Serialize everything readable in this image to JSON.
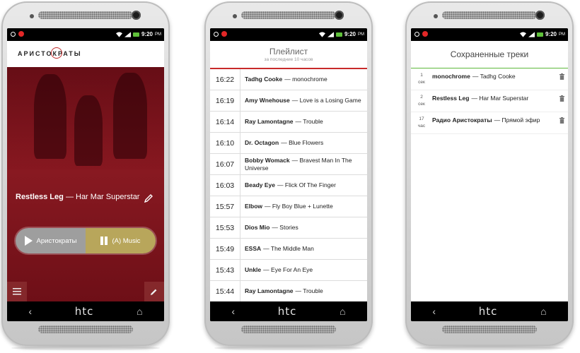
{
  "status_time": "9:20",
  "status_ampm": "PM",
  "nav_brand": "htc",
  "phone1": {
    "logo": "АРИСТОКРАТЫ",
    "artist": "Restless Leg",
    "title": "Har Mar Superstar",
    "btn_primary": "Аристократы",
    "btn_secondary": "(A) Music"
  },
  "playlist": {
    "title": "Плейлист",
    "subtitle": "за последние 10 часов",
    "items": [
      {
        "time": "16:22",
        "artist": "Tadhg Cooke",
        "title": "monochrome"
      },
      {
        "time": "16:19",
        "artist": "Amy Wnehouse",
        "title": "Love is a Losing Game"
      },
      {
        "time": "16:14",
        "artist": "Ray Lamontagne",
        "title": "Trouble"
      },
      {
        "time": "16:10",
        "artist": "Dr. Octagon",
        "title": "Blue Flowers"
      },
      {
        "time": "16:07",
        "artist": "Bobby Womack",
        "title": "Bravest Man In The Universe"
      },
      {
        "time": "16:03",
        "artist": "Beady Eye",
        "title": "Flick Of The Finger"
      },
      {
        "time": "15:57",
        "artist": "Elbow",
        "title": "Fly Boy Blue + Lunette"
      },
      {
        "time": "15:53",
        "artist": "Dios Mio",
        "title": "Stories"
      },
      {
        "time": "15:49",
        "artist": "ESSA",
        "title": "The Middle Man"
      },
      {
        "time": "15:43",
        "artist": "Unkle",
        "title": "Eye For An Eye"
      },
      {
        "time": "15:44",
        "artist": "Ray Lamontagne",
        "title": "Trouble"
      }
    ]
  },
  "saved": {
    "title": "Сохраненные треки",
    "items": [
      {
        "ago_num": "1",
        "ago_unit": "сек",
        "artist": "monochrome",
        "title": "Tadhg Cooke"
      },
      {
        "ago_num": "2",
        "ago_unit": "сек",
        "artist": "Restless Leg",
        "title": "Har Mar Superstar"
      },
      {
        "ago_num": "17",
        "ago_unit": "час",
        "artist": "Радио Аристократы",
        "title": "Прямой эфир"
      }
    ]
  },
  "colors": {
    "accent_red": "#c82a2a",
    "accent_green": "#5cb73a",
    "gold": "#b8a65b"
  }
}
